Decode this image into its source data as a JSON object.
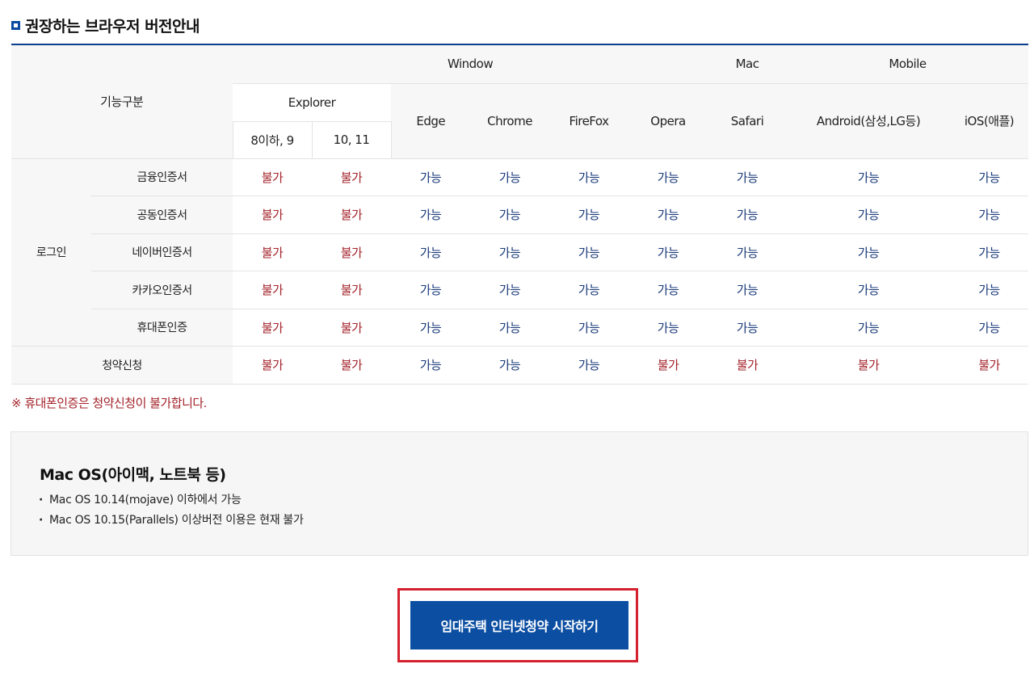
{
  "section_title": "권장하는 브라우저 버전안내",
  "table": {
    "feature_header": "기능구분",
    "group_window": "Window",
    "group_mac": "Mac",
    "group_mobile": "Mobile",
    "explorer": "Explorer",
    "explorer_versions": [
      "8이하, 9",
      "10, 11"
    ],
    "browsers": [
      "Edge",
      "Chrome",
      "FireFox",
      "Opera",
      "Safari",
      "Android(삼성,LG등)",
      "iOS(애플)"
    ],
    "login_category": "로그인",
    "rows": [
      {
        "label": "금융인증서",
        "values": [
          "불가",
          "불가",
          "가능",
          "가능",
          "가능",
          "가능",
          "가능",
          "가능",
          "가능"
        ]
      },
      {
        "label": "공동인증서",
        "values": [
          "불가",
          "불가",
          "가능",
          "가능",
          "가능",
          "가능",
          "가능",
          "가능",
          "가능"
        ]
      },
      {
        "label": "네이버인증서",
        "values": [
          "불가",
          "불가",
          "가능",
          "가능",
          "가능",
          "가능",
          "가능",
          "가능",
          "가능"
        ]
      },
      {
        "label": "카카오인증서",
        "values": [
          "불가",
          "불가",
          "가능",
          "가능",
          "가능",
          "가능",
          "가능",
          "가능",
          "가능"
        ]
      },
      {
        "label": "휴대폰인증",
        "values": [
          "불가",
          "불가",
          "가능",
          "가능",
          "가능",
          "가능",
          "가능",
          "가능",
          "가능"
        ]
      }
    ],
    "application_row": {
      "label": "청약신청",
      "values": [
        "불가",
        "불가",
        "가능",
        "가능",
        "가능",
        "불가",
        "불가",
        "불가",
        "불가"
      ]
    }
  },
  "note": "※ 휴대폰인증은 청약신청이 불가합니다.",
  "info_box": {
    "title": "Mac OS(아이맥, 노트북 등)",
    "items": [
      "Mac OS 10.14(mojave) 이하에서 가능",
      "Mac OS 10.15(Parallels) 이상버전 이용은 현재 불가"
    ]
  },
  "cta_button": "임대주택 인터넷청약 시작하기",
  "colors": {
    "primary": "#0b4ea2",
    "unavailable": "#a3232b",
    "available": "#1a3a7a",
    "highlight_frame": "#d5202e"
  }
}
